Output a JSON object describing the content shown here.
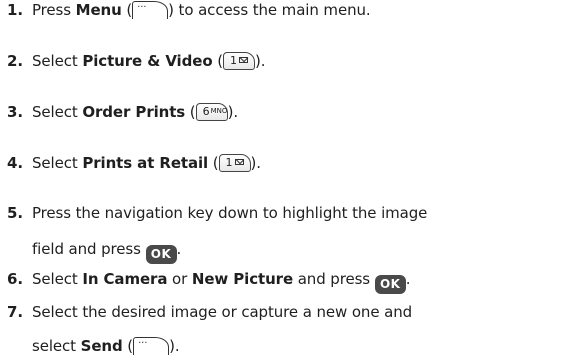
{
  "steps": [
    {
      "num": "1.",
      "pre": "Press ",
      "bold": "Menu",
      "post": " (",
      "key": "Menu softkey",
      "end": ") to access the main menu."
    },
    {
      "num": "2.",
      "pre": "Select ",
      "bold": "Picture & Video",
      "post": " (",
      "key": "1",
      "end": ")."
    },
    {
      "num": "3.",
      "pre": "Select ",
      "bold": "Order Prints",
      "post": " (",
      "key": "6 MNO",
      "end": ")."
    },
    {
      "num": "4.",
      "pre": "Select ",
      "bold": "Prints at Retail",
      "post": " (",
      "key": "1",
      "end": ")."
    },
    {
      "num": "5.",
      "line1": "Press the navigation key down to highlight the image",
      "line2_pre": "field and press ",
      "ok": "OK",
      "line2_end": "."
    },
    {
      "num": "6.",
      "pre": "Select ",
      "bold": "In Camera",
      "mid": " or ",
      "bold2": "New Picture",
      "post2": " and press ",
      "ok": "OK",
      "end": "."
    },
    {
      "num": "7.",
      "line1": "Select the desired image or capture a new one and",
      "line2_pre": "select ",
      "bold": "Send",
      "post": " (",
      "key": "Send softkey",
      "end": ")."
    }
  ],
  "keys": {
    "digit1": "1",
    "digit6": "6",
    "mno": "MNO",
    "dots": "···",
    "ok": "OK"
  },
  "colors": {
    "text": "#1f1f1f",
    "ok_key_bg": "#4a4a4a"
  }
}
